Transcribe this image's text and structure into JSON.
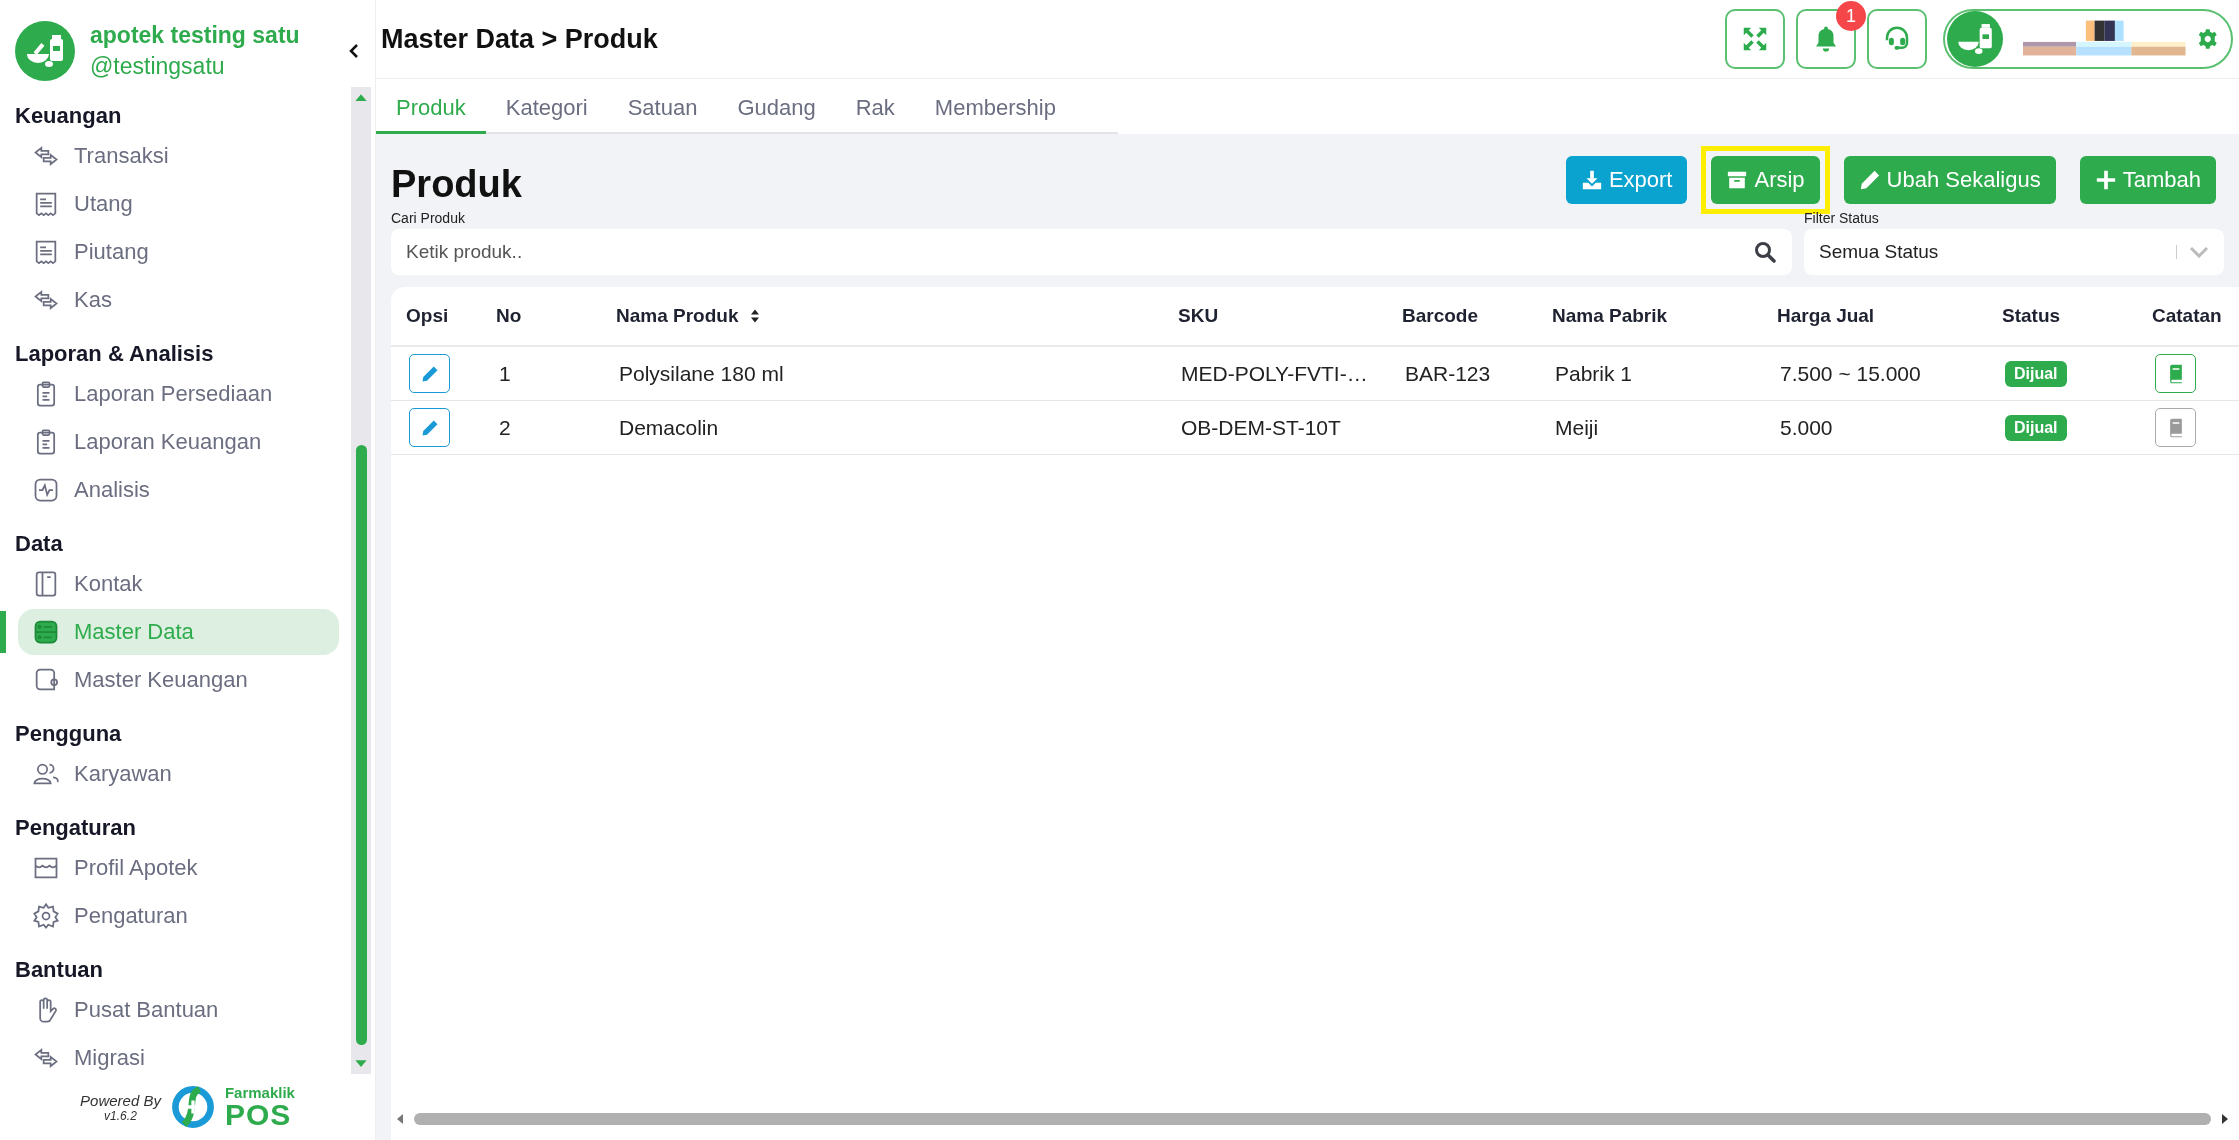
{
  "sidebar": {
    "brand": {
      "name": "apotek testing satu",
      "handle": "@testingsatu"
    },
    "sections": [
      {
        "title": "Keuangan",
        "items": [
          {
            "label": "Transaksi",
            "kind": "transfer",
            "selected": false
          },
          {
            "label": "Utang",
            "kind": "receipt",
            "selected": false
          },
          {
            "label": "Piutang",
            "kind": "receipt",
            "selected": false
          },
          {
            "label": "Kas",
            "kind": "transfer",
            "selected": false
          }
        ]
      },
      {
        "title": "Laporan & Analisis",
        "items": [
          {
            "label": "Laporan Persediaan",
            "kind": "clipboard",
            "selected": false
          },
          {
            "label": "Laporan Keuangan",
            "kind": "clipboard",
            "selected": false
          },
          {
            "label": "Analisis",
            "kind": "pulse",
            "selected": false
          }
        ]
      },
      {
        "title": "Data",
        "items": [
          {
            "label": "Kontak",
            "kind": "book",
            "selected": false
          },
          {
            "label": "Master Data",
            "kind": "server",
            "selected": true
          },
          {
            "label": "Master Keuangan",
            "kind": "wallet",
            "selected": false
          }
        ]
      },
      {
        "title": "Pengguna",
        "items": [
          {
            "label": "Karyawan",
            "kind": "users",
            "selected": false
          }
        ]
      },
      {
        "title": "Pengaturan",
        "items": [
          {
            "label": "Profil Apotek",
            "kind": "store",
            "selected": false
          },
          {
            "label": "Pengaturan",
            "kind": "gear",
            "selected": false
          }
        ]
      },
      {
        "title": "Bantuan",
        "items": [
          {
            "label": "Pusat Bantuan",
            "kind": "hand",
            "selected": false
          },
          {
            "label": "Migrasi",
            "kind": "transfer",
            "selected": false
          }
        ]
      }
    ],
    "footer": {
      "powered_by": "Powered By",
      "version": "v1.6.2",
      "logo_top": "Farmaklik",
      "logo_bottom": "POS"
    }
  },
  "header": {
    "breadcrumb": "Master Data > Produk",
    "notification_count": "1"
  },
  "tabs": [
    {
      "label": "Produk",
      "selected": true
    },
    {
      "label": "Kategori",
      "selected": false
    },
    {
      "label": "Satuan",
      "selected": false
    },
    {
      "label": "Gudang",
      "selected": false
    },
    {
      "label": "Rak",
      "selected": false
    },
    {
      "label": "Membership",
      "selected": false
    }
  ],
  "page": {
    "title": "Produk",
    "buttons": [
      {
        "label": "Export",
        "kind": "export",
        "highlighted": false
      },
      {
        "label": "Arsip",
        "kind": "archive",
        "highlighted": true
      },
      {
        "label": "Ubah Sekaligus",
        "kind": "edit",
        "highlighted": false
      },
      {
        "label": "Tambah",
        "kind": "add",
        "highlighted": false
      }
    ],
    "search": {
      "label": "Cari Produk",
      "placeholder": "Ketik produk.."
    },
    "filter": {
      "label": "Filter Status",
      "value": "Semua Status"
    }
  },
  "table": {
    "columns": [
      {
        "label": "Opsi",
        "sortable": false
      },
      {
        "label": "No",
        "sortable": false
      },
      {
        "label": "Nama Produk",
        "sortable": true
      },
      {
        "label": "SKU",
        "sortable": false
      },
      {
        "label": "Barcode",
        "sortable": false
      },
      {
        "label": "Nama Pabrik",
        "sortable": false
      },
      {
        "label": "Harga Jual",
        "sortable": false
      },
      {
        "label": "Status",
        "sortable": false
      },
      {
        "label": "Catatan",
        "sortable": false
      }
    ],
    "rows": [
      {
        "no": "1",
        "name": "Polysilane 180 ml",
        "sku": "MED-POLY-FVTI-…",
        "barcode": "BAR-123",
        "factory": "Pabrik 1",
        "price": "7.500 ~ 15.000",
        "status": "Dijual",
        "has_note": true
      },
      {
        "no": "2",
        "name": "Demacolin",
        "sku": "OB-DEM-ST-10T",
        "barcode": "",
        "factory": "Meiji",
        "price": "5.000",
        "status": "Dijual",
        "has_note": false
      }
    ]
  }
}
